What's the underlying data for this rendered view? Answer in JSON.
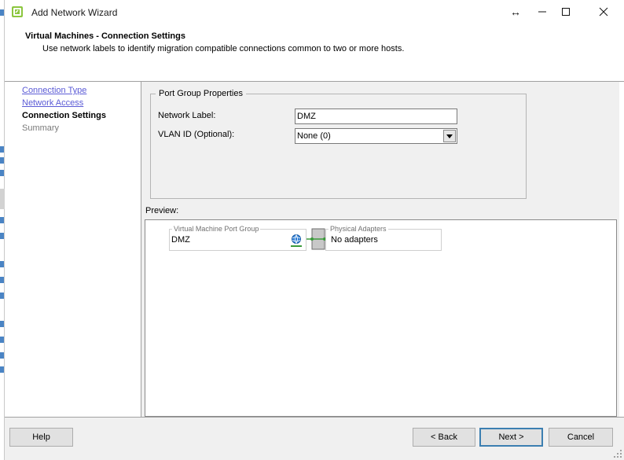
{
  "window": {
    "title": "Add Network Wizard",
    "move_glyph": "↔",
    "minimize_glyph": "—",
    "maximize_glyph": "☐",
    "close_glyph": "✕"
  },
  "header": {
    "title": "Virtual Machines - Connection Settings",
    "subtitle": "Use network labels to identify migration compatible connections common to two or more hosts."
  },
  "nav": {
    "items": [
      {
        "label": "Connection Type",
        "state": "link"
      },
      {
        "label": "Network Access",
        "state": "link"
      },
      {
        "label": "Connection Settings",
        "state": "current"
      },
      {
        "label": "Summary",
        "state": "disabled"
      }
    ]
  },
  "port_group": {
    "legend": "Port Group Properties",
    "network_label_caption": "Network Label:",
    "network_label_value": "DMZ",
    "vlan_caption": "VLAN ID (Optional):",
    "vlan_value": "None (0)"
  },
  "preview": {
    "label": "Preview:",
    "vm_port_group_legend": "Virtual Machine Port Group",
    "vm_port_group_value": "DMZ",
    "physical_adapters_legend": "Physical Adapters",
    "physical_adapters_value": "No adapters",
    "icon": "network-globe-icon"
  },
  "footer": {
    "help_label": "Help",
    "back_label": "< Back",
    "next_label": "Next >",
    "cancel_label": "Cancel"
  },
  "colors": {
    "link": "#5b5bd6",
    "default_button_border": "#3c7fb1",
    "dialog_bg": "#f0f0f0"
  }
}
